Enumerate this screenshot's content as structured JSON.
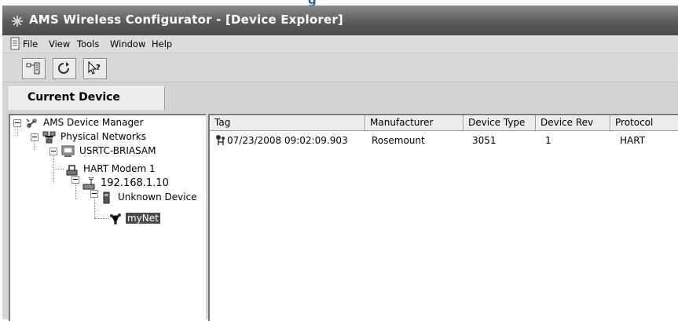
{
  "window": {
    "title": "AMS Wireless Configurator - [Device Explorer]"
  },
  "menu": {
    "items": [
      "File",
      "View",
      "Tools",
      "Window",
      "Help"
    ]
  },
  "toolbar": {
    "buttons": [
      "network-icon",
      "refresh-icon",
      "help-pointer-icon"
    ]
  },
  "current_device": {
    "tab_label": "Current Device"
  },
  "tree": {
    "nodes": [
      {
        "label": "AMS Device Manager",
        "icon": "ams-device-manager-icon"
      },
      {
        "label": "Physical Networks",
        "icon": "physical-networks-icon"
      },
      {
        "label": "USRTC-BRIASAM",
        "icon": "computer-icon"
      },
      {
        "label": "HART Modem 1",
        "icon": "hart-modem-icon"
      },
      {
        "label": "192.168.1.10",
        "icon": "wireless-gateway-icon"
      },
      {
        "label": "Unknown Device",
        "icon": "device-icon"
      },
      {
        "label": "myNet",
        "icon": "wireless-network-icon",
        "selected": true
      }
    ]
  },
  "table": {
    "columns": [
      "Tag",
      "Manufacturer",
      "Device Type",
      "Device Rev",
      "Protocol"
    ],
    "rows": [
      {
        "tag": "07/23/2008 09:02:09.903",
        "manufacturer": "Rosemount",
        "device_type": "3051",
        "device_rev": "1",
        "protocol": "HART"
      }
    ]
  }
}
